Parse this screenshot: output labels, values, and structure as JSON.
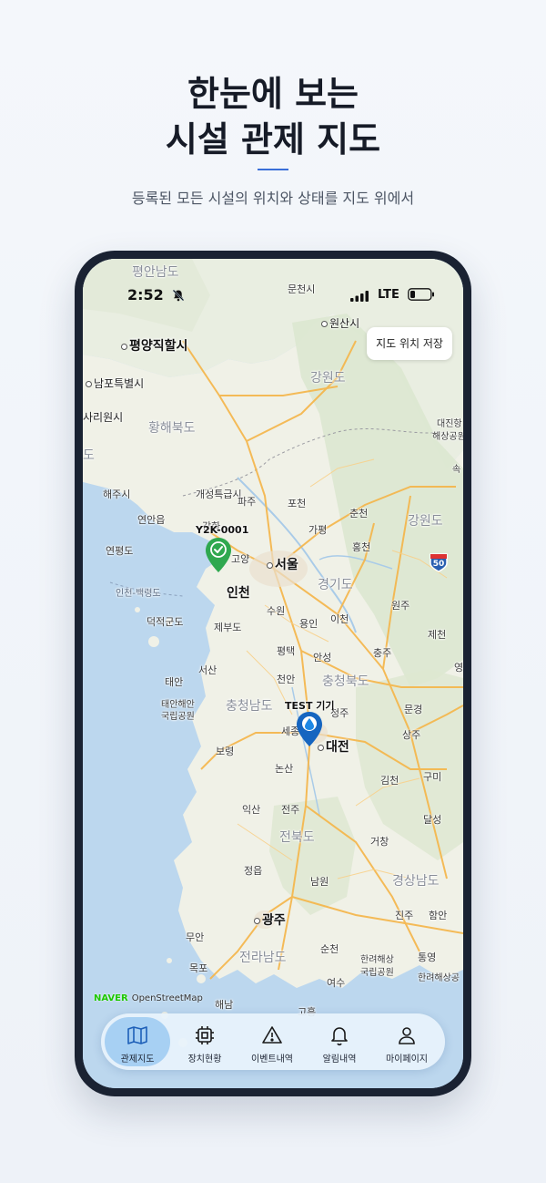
{
  "promo": {
    "title_line1": "한눈에 보는",
    "title_line2": "시설 관제 지도",
    "subtitle": "등록된 모든 시설의 위치와 상태를 지도 위에서"
  },
  "status_bar": {
    "time": "2:52",
    "network": "LTE"
  },
  "map": {
    "save_button_label": "지도 위치 저장",
    "attribution_brand": "NAVER",
    "attribution_osm": "OpenStreetMap",
    "labels": {
      "pyeongannamdo": "평안남도",
      "munchon": "문천시",
      "wonsan": "원산시",
      "pyongyang": "평양직할시",
      "nampo": "남포특별시",
      "sariwon": "사리원시",
      "gangwondo_n": "강원도",
      "hwanghaebukdo": "황해북도",
      "daejin": "대진항",
      "daejin2": "해상공원",
      "sok": "속",
      "dodo": "도",
      "haeju": "해주시",
      "gaesong": "개성특급시",
      "pocheon": "포천",
      "chuncheon": "춘천",
      "gangwondo_s": "강원도",
      "yeonan": "연안읍",
      "ganghwa": "강화",
      "paju": "파주",
      "gapyeong": "가평",
      "hongcheon": "홍천",
      "yeonpyeong": "연평도",
      "goyang": "고양",
      "seoul": "서울",
      "highway": "50",
      "gyeonggido": "경기도",
      "incheon_baengnyeong": "인천-백령도",
      "incheon": "인천",
      "suwon": "수원",
      "wonju": "원주",
      "deokjeok": "덕적군도",
      "jebu": "제부도",
      "yongin": "용인",
      "icheon": "이천",
      "jecheon": "제천",
      "pyeongtaek": "평택",
      "anseong": "안성",
      "chungju": "충주",
      "seosan": "서산",
      "taean": "태안",
      "cheonan": "천안",
      "chungcheongbukdo": "충청북도",
      "yeong": "영",
      "taean_park1": "태안해안",
      "taean_park2": "국립공원",
      "chungcheongnamdo": "충청남도",
      "cheongju": "청주",
      "mungyeong": "문경",
      "sejong": "세종",
      "daejeon": "대전",
      "sangju": "상주",
      "boryeong": "보령",
      "gumi": "구미",
      "nonsan": "논산",
      "gimcheon": "김천",
      "iksan": "익산",
      "jeonju": "전주",
      "dalseong": "달성",
      "jeollabukdo": "전북도",
      "geochang": "거창",
      "jeongeup": "정읍",
      "namwon": "남원",
      "gyeongsangnamdo": "경상남도",
      "gwangju": "광주",
      "jinju": "진주",
      "haman": "함안",
      "muan": "무안",
      "suncheon": "순천",
      "jeollanamdo": "전라남도",
      "hallyeo1": "한려해상",
      "hallyeo2": "국립공원",
      "tongyeong": "통영",
      "mokpo": "목포",
      "yeosu": "여수",
      "hallyeo3": "한려해상공",
      "haenam": "해남",
      "goheung": "고흥"
    }
  },
  "devices": [
    {
      "name": "Y2K-0001",
      "status": "normal",
      "color": "#28a745"
    },
    {
      "name": "TEST 기기",
      "status": "water",
      "color": "#1565c0"
    }
  ],
  "tabs": [
    {
      "label": "관제지도",
      "icon": "map-icon",
      "active": true
    },
    {
      "label": "장치현황",
      "icon": "chip-icon",
      "active": false
    },
    {
      "label": "이벤트내역",
      "icon": "warning-icon",
      "active": false
    },
    {
      "label": "알림내역",
      "icon": "bell-icon",
      "active": false
    },
    {
      "label": "마이페이지",
      "icon": "person-icon",
      "active": false
    }
  ],
  "colors": {
    "accent": "#3a6fd8",
    "tab_active_bg": "#a7d0f3",
    "sea": "#bcd7ee",
    "land": "#eef0e6",
    "road": "#f5b548"
  }
}
